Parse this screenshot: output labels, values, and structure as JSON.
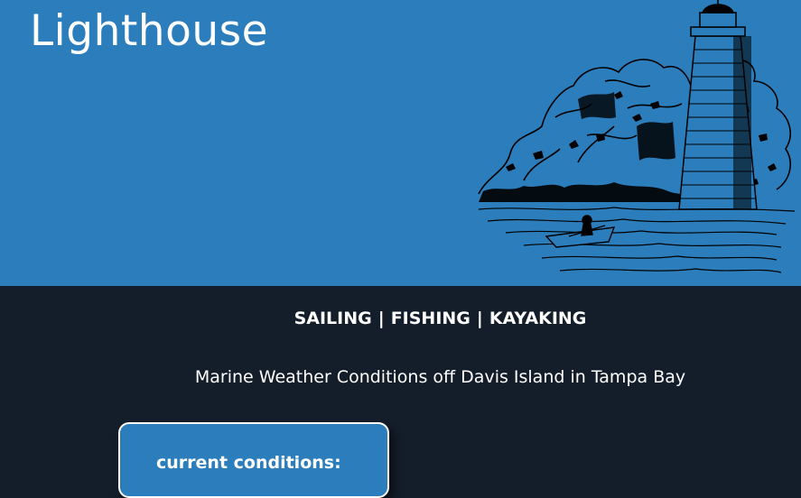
{
  "header": {
    "title": "Lighthouse",
    "illustration_icon": "lighthouse-illustration-icon",
    "background_color": "#2c7dbb"
  },
  "nav": {
    "items": [
      {
        "label": "SAILING"
      },
      {
        "label": "FISHING"
      },
      {
        "label": "KAYAKING"
      }
    ],
    "separator": "|"
  },
  "main": {
    "subtitle": "Marine Weather Conditions off Davis Island in Tampa Bay",
    "background_color": "#141d2a",
    "conditions_card": {
      "title": "current conditions:"
    }
  }
}
